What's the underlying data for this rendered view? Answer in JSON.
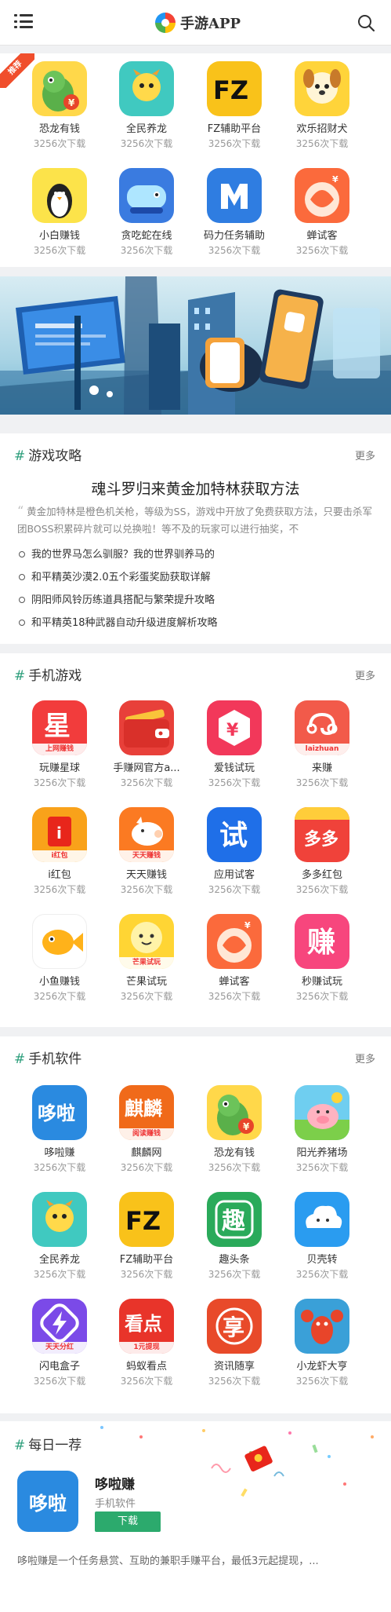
{
  "header": {
    "logo_text": "手游APP"
  },
  "recommend": {
    "ribbon": "推荐",
    "apps": [
      {
        "name": "恐龙有钱",
        "count": "3256次下载",
        "icon": "dinosaur-money-icon",
        "color": "#ffd84a"
      },
      {
        "name": "全民养龙",
        "count": "3256次下载",
        "icon": "dragon-pet-icon",
        "color": "#40c9c0"
      },
      {
        "name": "FZ辅助平台",
        "count": "3256次下载",
        "icon": "fz-logo-icon",
        "color": "#f9c21a"
      },
      {
        "name": "欢乐招财犬",
        "count": "3256次下载",
        "icon": "fortune-dog-icon",
        "color": "#ffd43a"
      },
      {
        "name": "小白赚钱",
        "count": "3256次下载",
        "icon": "penguin-icon",
        "color": "#fce34a"
      },
      {
        "name": "贪吃蛇在线",
        "count": "3256次下载",
        "icon": "snake-game-icon",
        "color": "#3a7be0"
      },
      {
        "name": "码力任务辅助",
        "count": "3256次下载",
        "icon": "m-logo-icon",
        "color": "#2f7de1"
      },
      {
        "name": "蝉试客",
        "count": "3256次下载",
        "icon": "cicada-icon",
        "color": "#fb6a3c"
      }
    ]
  },
  "guides": {
    "title": "游戏攻略",
    "more": "更多",
    "headline": "魂斗罗归来黄金加特林获取方法",
    "desc": "黄金加特林是橙色机关枪，等级为SS，游戏中开放了免费获取方法，只要击杀军团BOSS积累碎片就可以兑换啦！等不及的玩家可以进行抽奖，不",
    "items": [
      "我的世界马怎么驯服？我的世界驯养马的",
      "和平精英沙漠2.0五个彩蛋奖励获取详解",
      "阴阳师风铃历练道具搭配与繁荣提升攻略",
      "和平精英18种武器自动升级进度解析攻略"
    ]
  },
  "games": {
    "title": "手机游戏",
    "more": "更多",
    "apps": [
      {
        "name": "玩赚星球",
        "count": "3256次下载",
        "icon": "planet-icon",
        "color": "#f23c3c",
        "glyph": "星",
        "tag": "上网赚钱"
      },
      {
        "name": "手赚网官方a...",
        "count": "3256次下载",
        "icon": "wallet-icon",
        "color": "#e8403a"
      },
      {
        "name": "爱钱试玩",
        "count": "3256次下载",
        "icon": "yuan-hexagon-icon",
        "color": "#f2385a",
        "glyph": "¥"
      },
      {
        "name": "来赚",
        "count": "3256次下载",
        "icon": "laizhuan-icon",
        "color": "#f25a4a",
        "tag": "laizhuan"
      },
      {
        "name": "i红包",
        "count": "3256次下载",
        "icon": "red-packet-icon",
        "color": "#f9a21a",
        "glyph": "i",
        "tag": "i红包"
      },
      {
        "name": "天天赚钱",
        "count": "3256次下载",
        "icon": "piggy-icon",
        "color": "#fb7a22",
        "tag": "天天赚钱"
      },
      {
        "name": "应用试客",
        "count": "3256次下载",
        "icon": "shike-icon",
        "color": "#1f6fe8",
        "glyph": "试"
      },
      {
        "name": "多多红包",
        "count": "3256次下载",
        "icon": "duoduo-icon",
        "color": "#f0423a",
        "glyph": "多多"
      },
      {
        "name": "小鱼赚钱",
        "count": "3256次下载",
        "icon": "fish-icon",
        "color": "#ffffff"
      },
      {
        "name": "芒果试玩",
        "count": "3256次下载",
        "icon": "mango-icon",
        "color": "#ffd534",
        "tag": "芒果试玩"
      },
      {
        "name": "蝉试客",
        "count": "3256次下载",
        "icon": "cicada-icon",
        "color": "#fb6a3c"
      },
      {
        "name": "秒赚试玩",
        "count": "3256次下载",
        "icon": "zhuan-icon",
        "color": "#f7467d",
        "glyph": "赚"
      }
    ]
  },
  "software": {
    "title": "手机软件",
    "more": "更多",
    "apps": [
      {
        "name": "哆啦赚",
        "count": "3256次下载",
        "icon": "duola-icon",
        "color": "#2a8ae0",
        "glyph": "哆啦"
      },
      {
        "name": "麒麟网",
        "count": "3256次下载",
        "icon": "qilin-icon",
        "color": "#f06a1a",
        "glyph": "麒麟",
        "tag": "阅读赚钱"
      },
      {
        "name": "恐龙有钱",
        "count": "3256次下载",
        "icon": "dinosaur-money-icon",
        "color": "#ffd84a"
      },
      {
        "name": "阳光养猪场",
        "count": "3256次下载",
        "icon": "pig-farm-icon",
        "color": "#6fcef0"
      },
      {
        "name": "全民养龙",
        "count": "3256次下载",
        "icon": "dragon-pet-icon",
        "color": "#40c9c0"
      },
      {
        "name": "FZ辅助平台",
        "count": "3256次下载",
        "icon": "fz-logo-icon",
        "color": "#f9c21a"
      },
      {
        "name": "趣头条",
        "count": "3256次下载",
        "icon": "qutoutiao-icon",
        "color": "#2aaa5a",
        "glyph": "趣"
      },
      {
        "name": "贝壳转",
        "count": "3256次下载",
        "icon": "cloud-face-icon",
        "color": "#2a9cf0"
      },
      {
        "name": "闪电盒子",
        "count": "3256次下载",
        "icon": "lightning-box-icon",
        "color": "#7b4ae8",
        "tag": "天天分红"
      },
      {
        "name": "蚂蚁看点",
        "count": "3256次下载",
        "icon": "kandian-icon",
        "color": "#e8342a",
        "glyph": "看点",
        "tag": "1元提现"
      },
      {
        "name": "资讯随享",
        "count": "3256次下载",
        "icon": "xiang-icon",
        "color": "#e84a2a",
        "glyph": "享"
      },
      {
        "name": "小龙虾大亨",
        "count": "3256次下载",
        "icon": "crayfish-icon",
        "color": "#3aa0d8"
      }
    ]
  },
  "daily": {
    "title": "每日一荐",
    "app_name": "哆啦赚",
    "app_glyph": "哆啦",
    "category": "手机软件",
    "button": "下载",
    "desc": "哆啦赚是一个任务悬赏、互助的兼职手赚平台，最低3元起提现，..."
  }
}
